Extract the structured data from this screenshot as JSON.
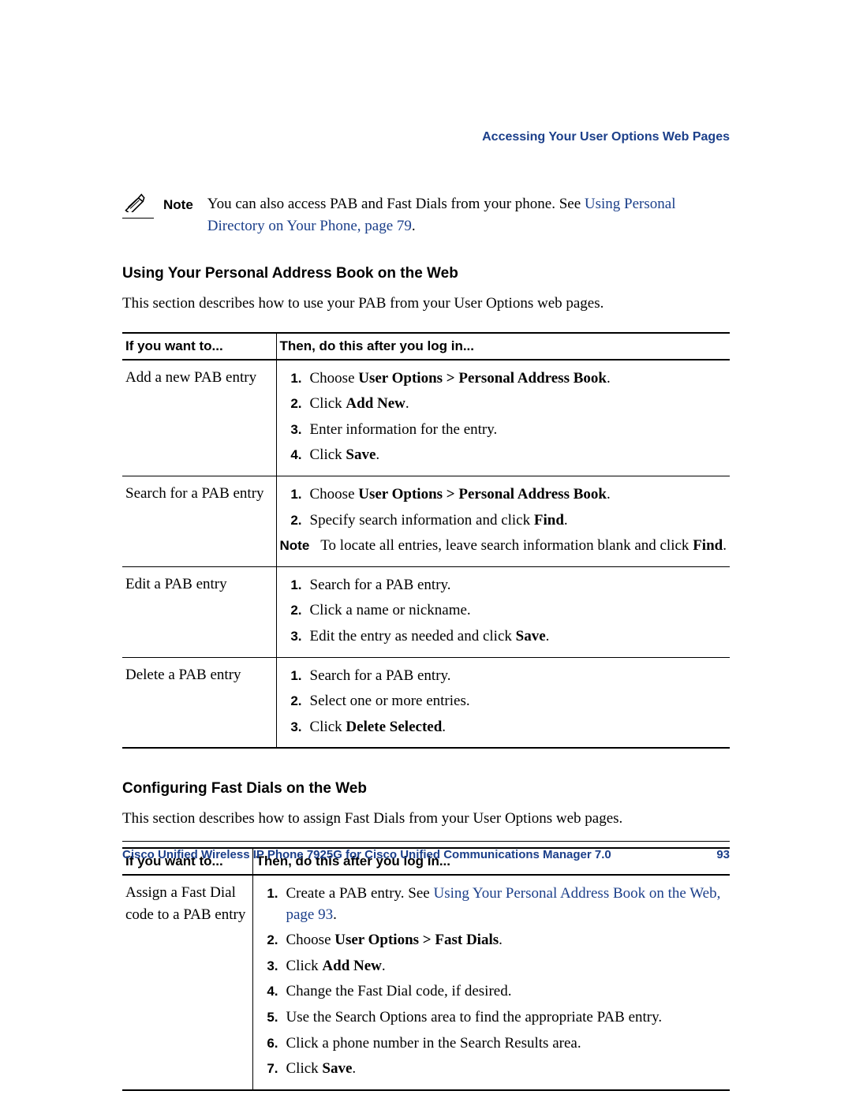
{
  "header": {
    "running_title": "Accessing Your User Options Web Pages"
  },
  "note": {
    "label": "Note",
    "text_before": "You can also access PAB and Fast Dials from your phone. See ",
    "link_text": "Using Personal Directory on Your Phone, page 79",
    "text_after": "."
  },
  "section1": {
    "heading": "Using Your Personal Address Book on the Web",
    "intro": "This section describes how to use your PAB from your User Options web pages.",
    "col1_header": "If you want to...",
    "col2_header": "Then, do this after you log in...",
    "rows": [
      {
        "task": "Add a new PAB entry",
        "steps": [
          {
            "pre": "Choose ",
            "bold": "User Options > Personal Address Book",
            "post": "."
          },
          {
            "pre": "Click ",
            "bold": "Add New",
            "post": "."
          },
          {
            "pre": "Enter information for the entry.",
            "bold": "",
            "post": ""
          },
          {
            "pre": "Click ",
            "bold": "Save",
            "post": "."
          }
        ]
      },
      {
        "task": "Search for a PAB entry",
        "steps": [
          {
            "pre": "Choose ",
            "bold": "User Options > Personal Address Book",
            "post": "."
          },
          {
            "pre": "Specify search information and click ",
            "bold": "Find",
            "post": "."
          }
        ],
        "note": {
          "label": "Note",
          "pre": "To locate all entries, leave search information blank and click ",
          "bold": "Find",
          "post": "."
        }
      },
      {
        "task": "Edit a PAB entry",
        "steps": [
          {
            "pre": "Search for a PAB entry.",
            "bold": "",
            "post": ""
          },
          {
            "pre": "Click a name or nickname.",
            "bold": "",
            "post": ""
          },
          {
            "pre": "Edit the entry as needed and click ",
            "bold": "Save",
            "post": "."
          }
        ]
      },
      {
        "task": "Delete a PAB entry",
        "steps": [
          {
            "pre": "Search for a PAB entry.",
            "bold": "",
            "post": ""
          },
          {
            "pre": "Select one or more entries.",
            "bold": "",
            "post": ""
          },
          {
            "pre": "Click ",
            "bold": "Delete Selected",
            "post": "."
          }
        ]
      }
    ]
  },
  "section2": {
    "heading": "Configuring Fast Dials on the Web",
    "intro": "This section describes how to assign Fast Dials from your User Options web pages.",
    "col1_header": "If you want to...",
    "col2_header": "Then, do this after you log in...",
    "row": {
      "task": "Assign a Fast Dial code to a PAB entry",
      "steps": [
        {
          "pre": "Create a PAB entry. See ",
          "link": "Using Your Personal Address Book on the Web, page 93",
          "post": "."
        },
        {
          "pre": "Choose ",
          "bold": "User Options > Fast Dials",
          "post": "."
        },
        {
          "pre": "Click ",
          "bold": "Add New",
          "post": "."
        },
        {
          "pre": "Change the Fast Dial code, if desired.",
          "bold": "",
          "post": ""
        },
        {
          "pre": "Use the Search Options area to find the appropriate PAB entry.",
          "bold": "",
          "post": ""
        },
        {
          "pre": "Click a phone number in the Search Results area.",
          "bold": "",
          "post": ""
        },
        {
          "pre": "Click ",
          "bold": "Save",
          "post": "."
        }
      ]
    }
  },
  "footer": {
    "title": "Cisco Unified Wireless IP Phone 7925G for Cisco Unified Communications Manager 7.0",
    "page": "93"
  }
}
